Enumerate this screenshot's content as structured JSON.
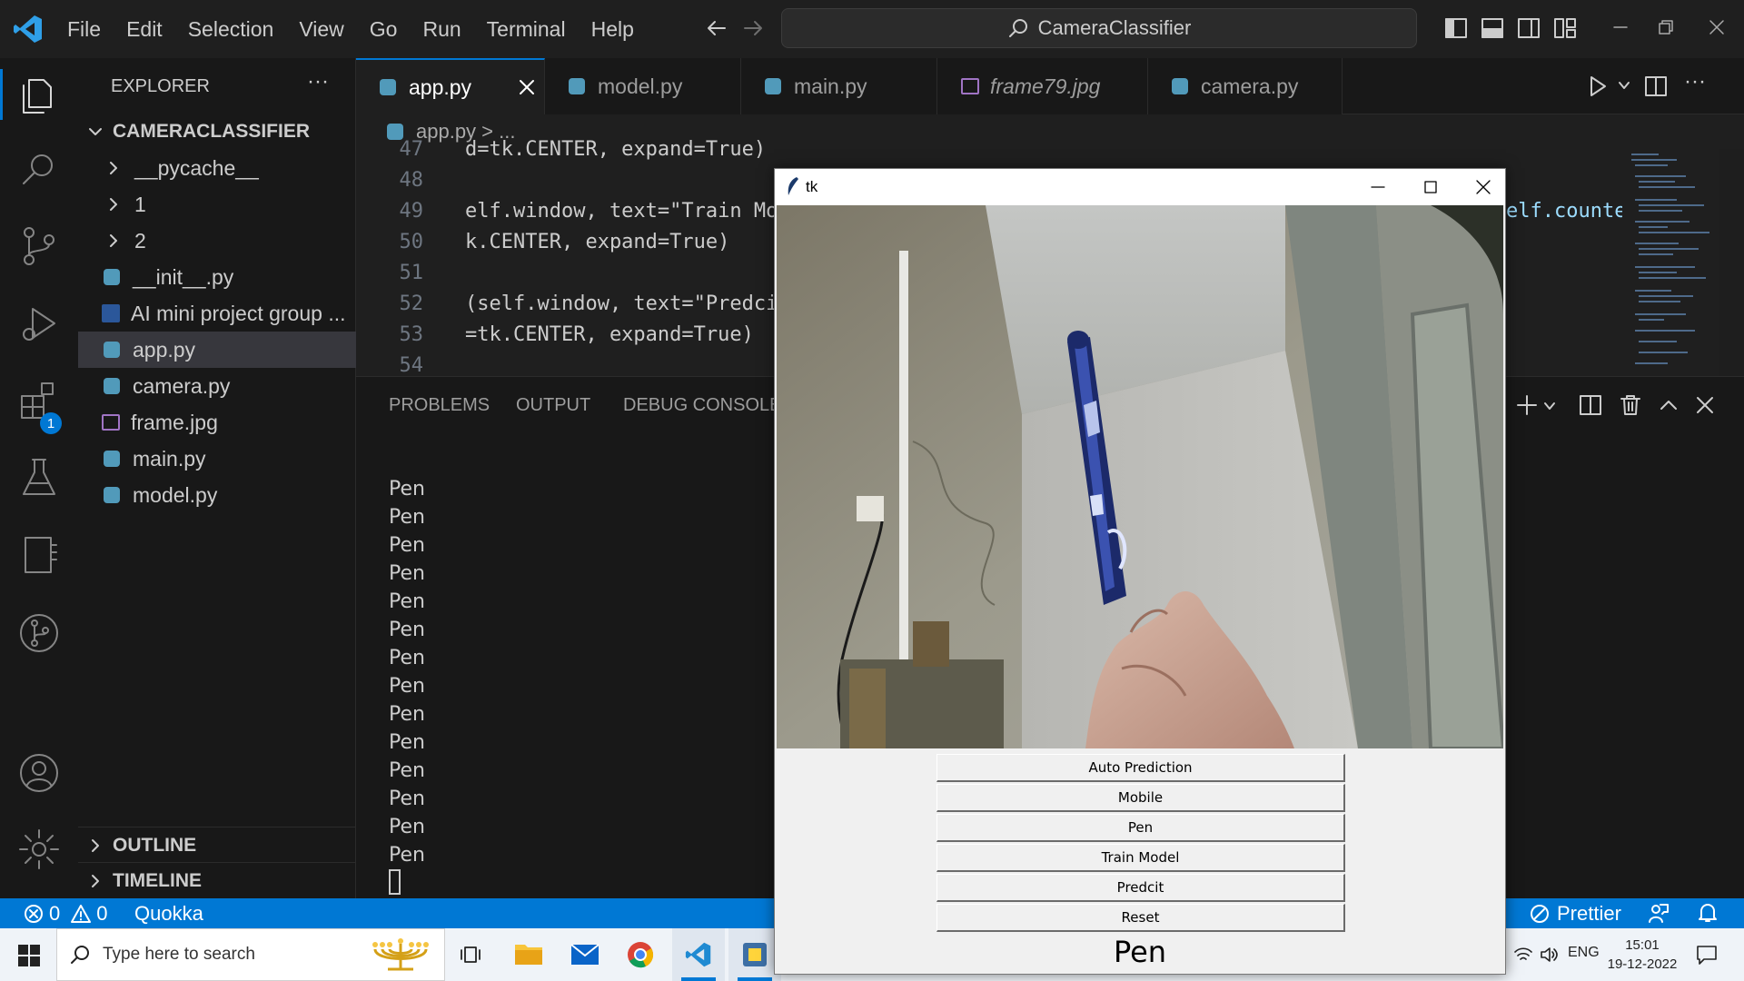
{
  "menu": [
    "File",
    "Edit",
    "Selection",
    "View",
    "Go",
    "Run",
    "Terminal",
    "Help"
  ],
  "search_text": "CameraClassifier",
  "sidebar": {
    "title": "EXPLORER",
    "project": "CAMERACLASSIFIER",
    "items": [
      {
        "label": "__pycache__",
        "type": "folder"
      },
      {
        "label": "1",
        "type": "folder"
      },
      {
        "label": "2",
        "type": "folder"
      },
      {
        "label": "__init__.py",
        "type": "py"
      },
      {
        "label": "AI mini project group ...",
        "type": "word"
      },
      {
        "label": "app.py",
        "type": "py"
      },
      {
        "label": "camera.py",
        "type": "py"
      },
      {
        "label": "frame.jpg",
        "type": "image"
      },
      {
        "label": "main.py",
        "type": "py"
      },
      {
        "label": "model.py",
        "type": "py"
      }
    ],
    "outline": "OUTLINE",
    "timeline": "TIMELINE"
  },
  "tabs": [
    "app.py",
    "model.py",
    "main.py",
    "frame79.jpg",
    "camera.py"
  ],
  "breadcrumb": "app.py > ...",
  "editor": {
    "lines": [
      {
        "n": "47",
        "code": "d=tk.CENTER, expand=True)"
      },
      {
        "n": "48",
        "code": ""
      },
      {
        "n": "49",
        "code": "elf.window, text=\"Train Model\""
      },
      {
        "n": "50",
        "code": "k.CENTER, expand=True)"
      },
      {
        "n": "51",
        "code": ""
      },
      {
        "n": "52",
        "code": "(self.window, text=\"Predcit\""
      },
      {
        "n": "53",
        "code": "=tk.CENTER, expand=True)"
      },
      {
        "n": "54",
        "code": ""
      }
    ],
    "right_fragment": "elf.counte"
  },
  "panel": {
    "tabs": [
      "PROBLEMS",
      "OUTPUT",
      "DEBUG CONSOLE"
    ],
    "terminal_lines": [
      "Pen",
      "Pen",
      "Pen",
      "Pen",
      "Pen",
      "Pen",
      "Pen",
      "Pen",
      "Pen",
      "Pen",
      "Pen",
      "Pen",
      "Pen",
      "Pen"
    ]
  },
  "status": {
    "errors": "0",
    "warnings": "0",
    "quokka": "Quokka",
    "prettier": "Prettier"
  },
  "activity_badge": "1",
  "taskbar": {
    "search_placeholder": "Type here to search",
    "lang": "ENG",
    "time": "15:01",
    "date": "19-12-2022"
  },
  "tk": {
    "title": "tk",
    "buttons": [
      "Auto Prediction",
      "Mobile",
      "Pen",
      "Train Model",
      "Predcit",
      "Reset"
    ],
    "prediction": "Pen"
  },
  "colors": {
    "accent": "#0078d4",
    "statusbar": "#0078d4",
    "editor_bg": "#1f1f1f",
    "sidebar_bg": "#181818"
  }
}
